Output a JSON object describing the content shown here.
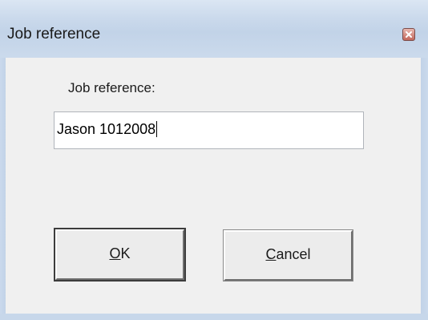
{
  "window": {
    "title": "Job reference",
    "close_icon": "close-icon"
  },
  "form": {
    "label": "Job reference:",
    "input_value": "Jason 1012008"
  },
  "buttons": {
    "ok_mnemonic": "O",
    "ok_rest": "K",
    "cancel_mnemonic": "C",
    "cancel_rest": "ancel"
  },
  "colors": {
    "titlebar": "#c2d3e8",
    "client_background": "#f0f0f0",
    "close_button": "#c2665b"
  }
}
